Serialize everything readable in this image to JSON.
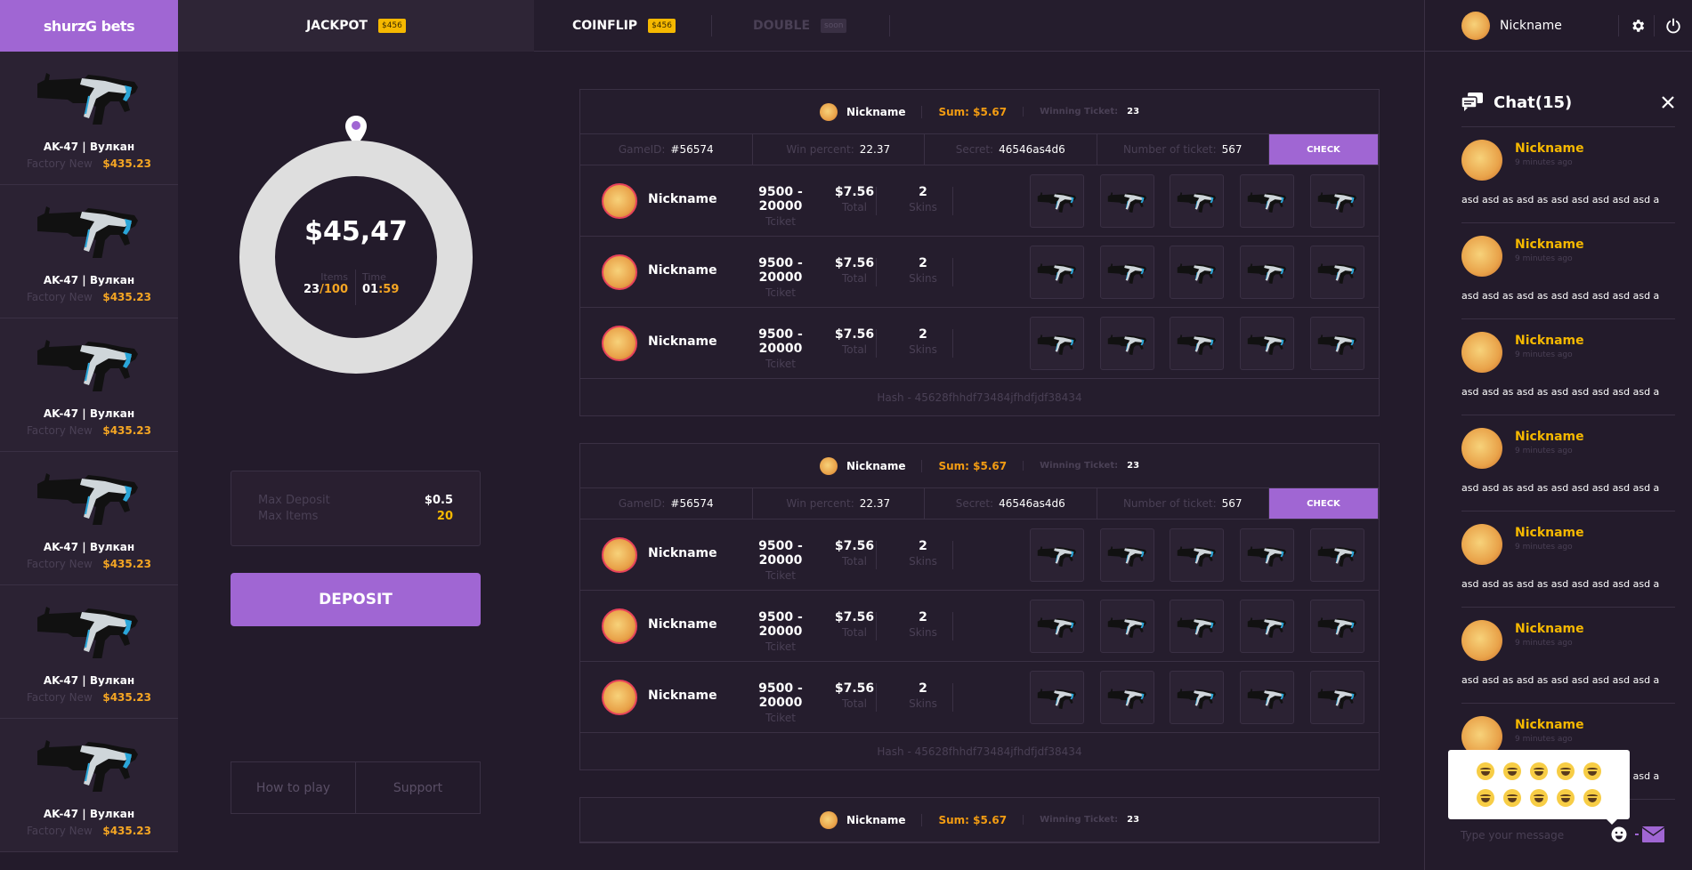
{
  "header": {
    "logo": "shurzG bets",
    "tabs": [
      {
        "label": "JACKPOT",
        "badge": "$456"
      },
      {
        "label": "COINFLIP",
        "badge": "$456"
      },
      {
        "label": "DOUBLE",
        "badge": "soon"
      }
    ],
    "user": {
      "name": "Nickname"
    }
  },
  "sidebar": {
    "items": [
      {
        "name": "AK-47 | Вулкан",
        "condition": "Factory New",
        "price": "$435.23"
      },
      {
        "name": "AK-47 | Вулкан",
        "condition": "Factory New",
        "price": "$435.23"
      },
      {
        "name": "AK-47 | Вулкан",
        "condition": "Factory New",
        "price": "$435.23"
      },
      {
        "name": "AK-47 | Вулкан",
        "condition": "Factory New",
        "price": "$435.23"
      },
      {
        "name": "AK-47 | Вулкан",
        "condition": "Factory New",
        "price": "$435.23"
      },
      {
        "name": "AK-47 | Вулкан",
        "condition": "Factory New",
        "price": "$435.23"
      }
    ]
  },
  "pot": {
    "amount": "$45,47",
    "items_label": "Items",
    "items_current": "23",
    "items_max": "/100",
    "time_label": "Time",
    "time_min": "01",
    "time_sec": ":59"
  },
  "limits": {
    "max_deposit_label": "Max Deposit",
    "max_deposit": "$0.5",
    "max_items_label": "Max Items",
    "max_items": "20"
  },
  "deposit_label": "DEPOSIT",
  "links": {
    "how_to_play": "How to play",
    "support": "Support"
  },
  "games": [
    {
      "winner": "Nickname",
      "sum": "Sum: $5.67",
      "winning_ticket_label": "Winning Ticket:",
      "winning_ticket": "23",
      "game_id_label": "GameID:",
      "game_id": "#56574",
      "win_percent_label": "Win percent:",
      "win_percent": "22.37",
      "secret_label": "Secret:",
      "secret": "46546as4d6",
      "tickets_label": "Number of ticket:",
      "tickets": "567",
      "check": "CHECK",
      "players": [
        {
          "name": "Nickname",
          "ticket": "9500 - 20000",
          "ticket_label": "Tciket",
          "total": "$7.56",
          "total_label": "Total",
          "skins": "2",
          "skins_label": "Skins"
        },
        {
          "name": "Nickname",
          "ticket": "9500 - 20000",
          "ticket_label": "Tciket",
          "total": "$7.56",
          "total_label": "Total",
          "skins": "2",
          "skins_label": "Skins"
        },
        {
          "name": "Nickname",
          "ticket": "9500 - 20000",
          "ticket_label": "Tciket",
          "total": "$7.56",
          "total_label": "Total",
          "skins": "2",
          "skins_label": "Skins"
        }
      ],
      "hash": "Hash - 45628fhhdf73484jfhdfjdf38434"
    },
    {
      "winner": "Nickname",
      "sum": "Sum: $5.67",
      "winning_ticket_label": "Winning Ticket:",
      "winning_ticket": "23",
      "game_id_label": "GameID:",
      "game_id": "#56574",
      "win_percent_label": "Win percent:",
      "win_percent": "22.37",
      "secret_label": "Secret:",
      "secret": "46546as4d6",
      "tickets_label": "Number of ticket:",
      "tickets": "567",
      "check": "CHECK",
      "players": [
        {
          "name": "Nickname",
          "ticket": "9500 - 20000",
          "ticket_label": "Tciket",
          "total": "$7.56",
          "total_label": "Total",
          "skins": "2",
          "skins_label": "Skins"
        },
        {
          "name": "Nickname",
          "ticket": "9500 - 20000",
          "ticket_label": "Tciket",
          "total": "$7.56",
          "total_label": "Total",
          "skins": "2",
          "skins_label": "Skins"
        },
        {
          "name": "Nickname",
          "ticket": "9500 - 20000",
          "ticket_label": "Tciket",
          "total": "$7.56",
          "total_label": "Total",
          "skins": "2",
          "skins_label": "Skins"
        }
      ],
      "hash": "Hash - 45628fhhdf73484jfhdfjdf38434"
    },
    {
      "winner": "Nickname",
      "sum": "Sum: $5.67",
      "winning_ticket_label": "Winning Ticket:",
      "winning_ticket": "23"
    }
  ],
  "chat": {
    "title": "Chat(15)",
    "placeholder": "Type your message",
    "messages": [
      {
        "name": "Nickname",
        "time": "9 minutes ago",
        "text": "asd asd as asd as asd asd asd asd asd a"
      },
      {
        "name": "Nickname",
        "time": "9 minutes ago",
        "text": "asd asd as asd as asd asd asd asd asd a"
      },
      {
        "name": "Nickname",
        "time": "9 minutes ago",
        "text": "asd asd as asd as asd asd asd asd asd a"
      },
      {
        "name": "Nickname",
        "time": "9 minutes ago",
        "text": "asd asd as asd as asd asd asd asd asd a"
      },
      {
        "name": "Nickname",
        "time": "9 minutes ago",
        "text": "asd asd as asd as asd asd asd asd asd a"
      },
      {
        "name": "Nickname",
        "time": "9 minutes ago",
        "text": "asd asd as asd as asd asd asd asd asd a"
      },
      {
        "name": "Nickname",
        "time": "9 minutes ago",
        "text": "asd asd as asd as asd asd asd asd asd a"
      }
    ],
    "emoji_count": 10
  },
  "colors": {
    "accent": "#a066d3",
    "orange": "#f5a623",
    "badge": "#f5b800",
    "background": "#231b2b"
  }
}
